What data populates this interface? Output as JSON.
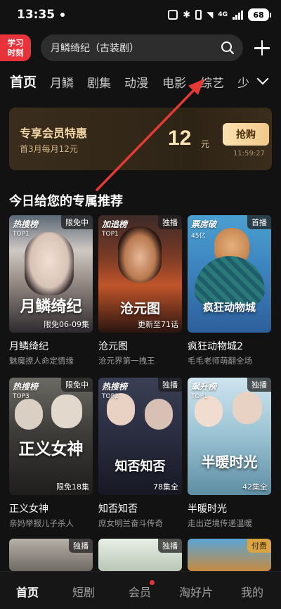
{
  "status": {
    "time": "13:35",
    "network": "4G",
    "battery": "68"
  },
  "header": {
    "study_badge_line1": "学习",
    "study_badge_line2": "时刻",
    "search_text": "月鳞绮纪（古装剧）"
  },
  "tabs": [
    "首页",
    "月鳞",
    "剧集",
    "动漫",
    "电影",
    "综艺",
    "少"
  ],
  "promo": {
    "title": "专享会员特惠",
    "subtitle": "首3月每月12元",
    "price": "12",
    "unit": "元",
    "button": "抢购",
    "timer": "11:59:27"
  },
  "section_title": "今日给您的专属推荐",
  "cards": [
    {
      "rank_name": "热搜榜",
      "rank_num": "TOP1",
      "tag": "限免中",
      "episode": "限免06-09集",
      "art": "月鳞绮纪",
      "title": "月鳞绮纪",
      "subtitle": "魅魔撩人命定情缘"
    },
    {
      "rank_name": "加追榜",
      "rank_num": "TOP1",
      "tag": "独播",
      "episode": "更新至71话",
      "art": "沧元图",
      "title": "沧元图",
      "subtitle": "沧元界第一拽王"
    },
    {
      "rank_name": "票房破",
      "rank_num": "45亿",
      "tag": "首播",
      "episode": "",
      "art": "疯狂动物城",
      "title": "疯狂动物城2",
      "subtitle": "毛毛老师萌翻全场"
    },
    {
      "rank_name": "热搜榜",
      "rank_num": "TOP3",
      "tag": "限免中",
      "episode": "限免18集",
      "art": "正义女神",
      "title": "正义女神",
      "subtitle": "亲妈举报儿子杀人"
    },
    {
      "rank_name": "热搜榜",
      "rank_num": "TOP2",
      "tag": "独播",
      "episode": "78集全",
      "art": "知否知否",
      "title": "知否知否",
      "subtitle": "庶女明兰奋斗传奇"
    },
    {
      "rank_name": "飙升榜",
      "rank_num": "TOP1",
      "tag": "独播",
      "episode": "42集全",
      "art": "半暖时光",
      "title": "半暖时光",
      "subtitle": "走出逆境传递温暖"
    },
    {
      "rank_name": "",
      "rank_num": "",
      "tag": "独播",
      "episode": "",
      "art": "",
      "title": "",
      "subtitle": ""
    },
    {
      "rank_name": "",
      "rank_num": "",
      "tag": "独播",
      "episode": "",
      "art": "",
      "title": "",
      "subtitle": ""
    },
    {
      "rank_name": "",
      "rank_num": "",
      "tag": "付费",
      "episode": "",
      "art": "",
      "title": "",
      "subtitle": ""
    }
  ],
  "bottom_nav": [
    "首页",
    "短剧",
    "会员",
    "淘好片",
    "我的"
  ],
  "colors": {
    "accent_red": "#e8333a",
    "promo_gold": "#f3d7a6",
    "annotation_arrow": "#e53935"
  }
}
